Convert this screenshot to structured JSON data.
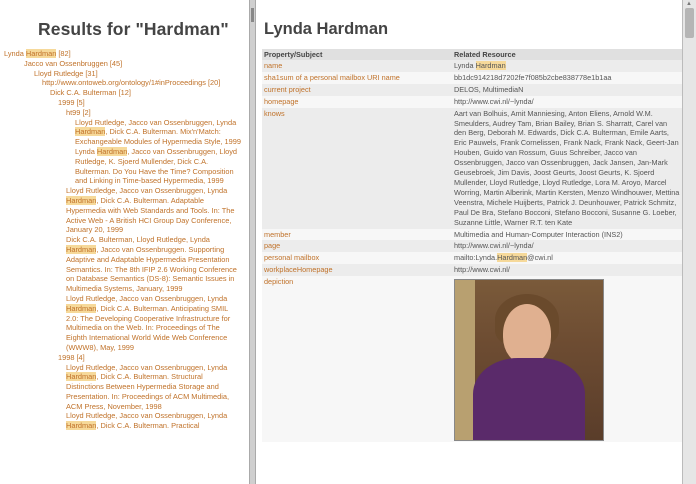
{
  "left": {
    "title": "Results for \"Hardman\"",
    "tree": [
      {
        "indent": 0,
        "parts": [
          "Lynda ",
          "Hardman",
          " [82]"
        ]
      },
      {
        "indent": 1,
        "parts": [
          "Jacco van Ossenbruggen [45]"
        ]
      },
      {
        "indent": 2,
        "parts": [
          "Lloyd Rutledge [31]"
        ]
      },
      {
        "indent": 3,
        "parts": [
          "http://www.ontoweb.org/ontology/1#inProceedings [20]"
        ]
      },
      {
        "indent": 4,
        "parts": [
          "Dick C.A. Bulterman [12]"
        ]
      },
      {
        "indent": 5,
        "parts": [
          "1999 [5]"
        ]
      },
      {
        "indent": 6,
        "parts": [
          "ht99 [2]"
        ]
      },
      {
        "indent": 7,
        "parts": [
          "Lloyd Rutledge, Jacco van Ossenbruggen, Lynda ",
          "Hardman",
          ", Dick C.A. Bulterman. Mix'n'Match: Exchangeable Modules of Hypermedia Style, 1999"
        ]
      },
      {
        "indent": 7,
        "parts": [
          "Lynda ",
          "Hardman",
          ", Jacco van Ossenbruggen, Lloyd Rutledge, K. Sjoerd Mullender, Dick C.A. Bulterman. Do You Have the Time? Composition and Linking in Time-based Hypermedia, 1999"
        ]
      },
      {
        "indent": 6,
        "parts": [
          "Lloyd Rutledge, Jacco van Ossenbruggen, Lynda ",
          "Hardman",
          ", Dick C.A. Bulterman. Adaptable Hypermedia with Web Standards and Tools. In: The Active Web - A British HCI Group Day Conference, January 20, 1999"
        ]
      },
      {
        "indent": 6,
        "parts": [
          "Dick C.A. Bulterman, Lloyd Rutledge, Lynda ",
          "Hardman",
          ", Jacco van Ossenbruggen. Supporting Adaptive and Adaptable Hypermedia Presentation Semantics. In: The 8th IFIP 2.6 Working Conference on Database Semantics (DS-8): Semantic Issues in Multimedia Systems, January, 1999"
        ]
      },
      {
        "indent": 6,
        "parts": [
          "Lloyd Rutledge, Jacco van Ossenbruggen, Lynda ",
          "Hardman",
          ", Dick C.A. Bulterman. Anticipating SMIL 2.0: The Developing Cooperative Infrastructure for Multimedia on the Web. In: Proceedings of The Eighth International World Wide Web Conference (WWW8), May, 1999"
        ]
      },
      {
        "indent": 5,
        "parts": [
          "1998 [4]"
        ]
      },
      {
        "indent": 6,
        "parts": [
          "Lloyd Rutledge, Jacco van Ossenbruggen, Lynda ",
          "Hardman",
          ", Dick C.A. Bulterman. Structural Distinctions Between Hypermedia Storage and Presentation. In: Proceedings of ACM Multimedia, ACM Press, November, 1998"
        ]
      },
      {
        "indent": 6,
        "parts": [
          "Lloyd Rutledge, Jacco van Ossenbruggen, Lynda ",
          "Hardman",
          ", Dick C.A. Bulterman. Practical"
        ]
      }
    ]
  },
  "right": {
    "title": "Lynda Hardman",
    "headers": [
      "Property/Subject",
      "Related Resource"
    ],
    "rows": [
      {
        "prop": "name",
        "val": [
          "Lynda ",
          "Hardman",
          ""
        ]
      },
      {
        "prop": "sha1sum of a personal mailbox URI name",
        "val": [
          "bb1dc914218d7202fe7f085b2cbe838778e1b1aa"
        ]
      },
      {
        "prop": "current project",
        "val": [
          "DELOS, MultimediaN"
        ]
      },
      {
        "prop": "homepage",
        "val": [
          "http://www.cwi.nl/~lynda/"
        ]
      },
      {
        "prop": "knows",
        "val": [
          "Aart van Bolhuis, Amit Manniesing, Anton Eliens, Arnold W.M. Smeulders, Audrey Tam, Brian Bailey, Brian S. Sharratt, Carel van den Berg, Deborah M. Edwards, Dick C.A. Bulterman, Emile Aarts, Eric Pauwels, Frank Cornelissen, Frank Nack, Frank Nack, Geert-Jan Houben, Guido van Rossum, Guus Schreiber, Jacco van Ossenbruggen, Jacco van Ossenbruggen, Jack Jansen, Jan-Mark Geusebroek, Jim Davis, Joost Geurts, Joost Geurts, K. Sjoerd Mullender, Lloyd Rutledge, Lloyd Rutledge, Lora M. Aroyo, Marcel Worring, Martin Alberink, Martin Kersten, Menzo Windhouwer, Mettina Veenstra, Michele Huijberts, Patrick J. Deunhouwer, Patrick Schmitz, Paul De Bra, Stefano Bocconi, Stefano Bocconi, Susanne G. Loeber, Suzanne Little, Warner R.T. ten Kate"
        ]
      },
      {
        "prop": "member",
        "val": [
          "Multimedia and Human-Computer Interaction (INS2)"
        ]
      },
      {
        "prop": "page",
        "val": [
          "http://www.cwi.nl/~lynda/"
        ]
      },
      {
        "prop": "personal mailbox",
        "val": [
          "mailto:Lynda.",
          "Hardman",
          "@cwi.nl"
        ]
      },
      {
        "prop": "workplaceHomepage",
        "val": [
          "http://www.cwi.nl/"
        ]
      },
      {
        "prop": "depiction",
        "val": [
          ""
        ],
        "photo": true
      }
    ]
  }
}
